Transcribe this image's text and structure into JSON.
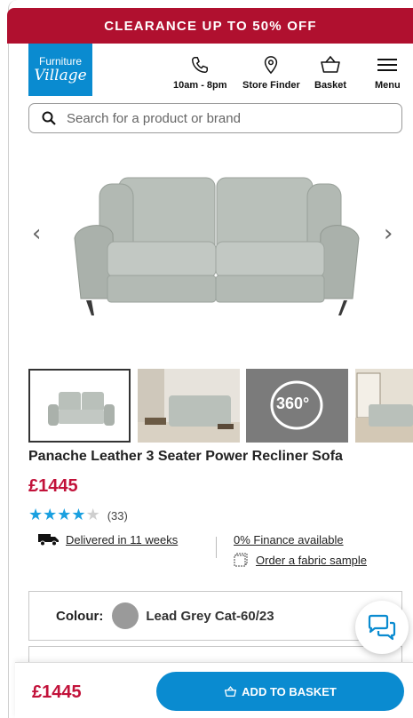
{
  "banner": {
    "text": "CLEARANCE UP TO 50% OFF"
  },
  "logo": {
    "line1": "Furniture",
    "line2": "Village"
  },
  "nav": {
    "hours": "10am - 8pm",
    "store_finder": "Store Finder",
    "basket": "Basket",
    "menu": "Menu"
  },
  "search": {
    "placeholder": "Search for a product or brand"
  },
  "gallery": {
    "prev": "‹",
    "next": "›",
    "badge_360": "360°"
  },
  "product": {
    "title": "Panache Leather 3 Seater Power Recliner Sofa",
    "price": "£1445",
    "rating": 4,
    "rating_max": 5,
    "review_count": "(33)"
  },
  "info": {
    "delivery": "Delivered in 11 weeks",
    "finance": "0% Finance available",
    "sample": "Order a fabric sample"
  },
  "colour": {
    "label": "Colour:",
    "value": "Lead Grey Cat-60/23"
  },
  "sticky": {
    "price": "£1445",
    "button": "ADD TO BASKET"
  },
  "colors": {
    "brand_red": "#b0102f",
    "brand_blue": "#0a8bd0",
    "price": "#c2123a",
    "star": "#1aa0e0"
  }
}
